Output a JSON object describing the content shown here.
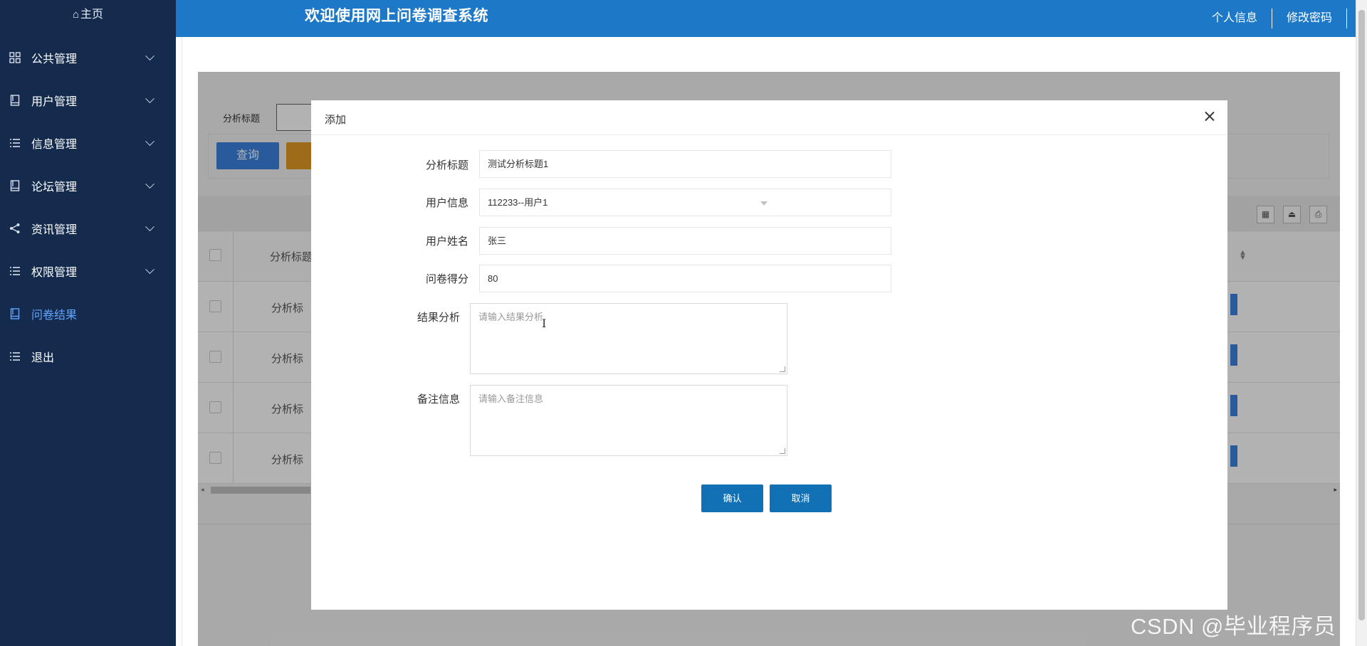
{
  "sidebar": {
    "home_label": "主页",
    "items": [
      {
        "label": "公共管理",
        "icon": "grid-icon"
      },
      {
        "label": "用户管理",
        "icon": "book-icon"
      },
      {
        "label": "信息管理",
        "icon": "list-icon"
      },
      {
        "label": "论坛管理",
        "icon": "book-icon"
      },
      {
        "label": "资讯管理",
        "icon": "share-icon"
      },
      {
        "label": "权限管理",
        "icon": "list-icon"
      },
      {
        "label": "问卷结果",
        "icon": "book-icon",
        "active": true
      },
      {
        "label": "退出",
        "icon": "list-icon"
      }
    ]
  },
  "header": {
    "title": "欢迎使用网上问卷调查系统",
    "links": [
      "个人信息",
      "修改密码"
    ]
  },
  "background": {
    "search_label": "分析标题",
    "query_button": "查询",
    "column_header": "分析标题",
    "row_cell": "分析标"
  },
  "modal": {
    "title": "添加",
    "fields": {
      "title_label": "分析标题",
      "title_value": "测试分析标题1",
      "user_info_label": "用户信息",
      "user_info_value": "112233--用户1",
      "user_name_label": "用户姓名",
      "user_name_value": "张三",
      "score_label": "问卷得分",
      "score_value": "80",
      "analysis_label": "结果分析",
      "analysis_placeholder": "请输入结果分析",
      "remark_label": "备注信息",
      "remark_placeholder": "请输入备注信息"
    },
    "confirm_label": "确认",
    "cancel_label": "取消"
  },
  "watermark": "CSDN @毕业程序员",
  "colors": {
    "sidebar_bg": "#142b4e",
    "header_bg": "#1d79c8",
    "active_menu": "#63a4ff",
    "primary_button": "#1270b5"
  }
}
